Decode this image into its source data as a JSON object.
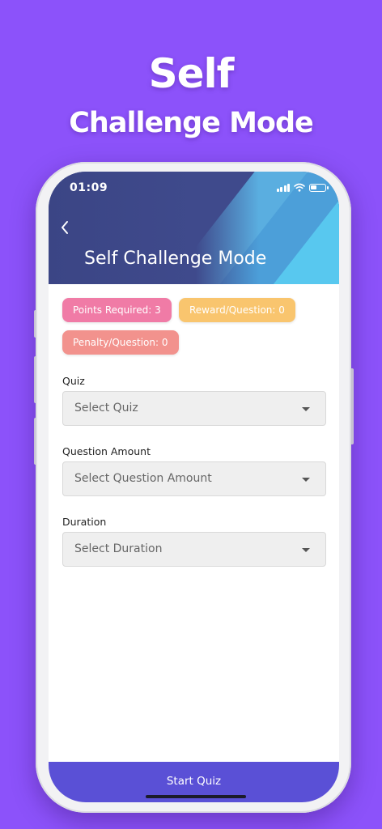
{
  "promo": {
    "line1": "Self",
    "line2": "Challenge Mode"
  },
  "status_bar": {
    "time": "01:09"
  },
  "header": {
    "title": "Self Challenge Mode",
    "back_icon": "chevron-left-icon"
  },
  "badges": {
    "points_required": "Points Required: 3",
    "reward_per_question": "Reward/Question: 0",
    "penalty_per_question": "Penalty/Question: 0"
  },
  "form": {
    "quiz": {
      "label": "Quiz",
      "placeholder": "Select Quiz"
    },
    "question_amount": {
      "label": "Question Amount",
      "placeholder": "Select Question Amount"
    },
    "duration": {
      "label": "Duration",
      "placeholder": "Select Duration"
    }
  },
  "footer": {
    "start_label": "Start Quiz"
  },
  "colors": {
    "background": "#8c52fa",
    "header": "#3f4a8c",
    "points_badge": "#f07ba6",
    "reward_badge": "#f9c56e",
    "penalty_badge": "#f2928d",
    "start_button": "#5a50d6"
  }
}
